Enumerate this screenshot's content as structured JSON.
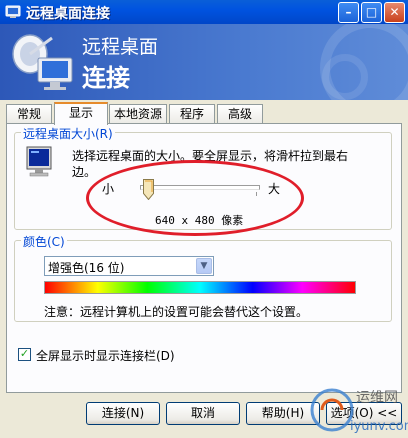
{
  "window": {
    "title": "远程桌面连接",
    "minimize": "–",
    "maximize": "□",
    "close": "✕"
  },
  "banner": {
    "line1": "远程桌面",
    "line2": "连接"
  },
  "tabs": [
    {
      "label": "常规"
    },
    {
      "label": "显示",
      "active": true
    },
    {
      "label": "本地资源"
    },
    {
      "label": "程序"
    },
    {
      "label": "高级"
    }
  ],
  "display_size": {
    "title": "远程桌面大小(R)",
    "description": "选择远程桌面的大小。要全屏显示，将滑杆拉到最右边。",
    "small_label": "小",
    "large_label": "大",
    "resolution": "640 x 480 像素",
    "slider_level": 0
  },
  "colors": {
    "title": "颜色(C)",
    "selected": "增强色(16 位)",
    "note": "注意：远程计算机上的设置可能会替代这个设置。"
  },
  "fullscreen_bar": {
    "label": "全屏显示时显示连接栏(D)",
    "checked": true
  },
  "buttons": {
    "connect": "连接(N)",
    "cancel": "取消",
    "help": "帮助(H)",
    "options": "选项(O) <<"
  },
  "watermark": {
    "text": "运维网",
    "url": "iyunv.com"
  },
  "accent": {
    "title_bar": "#0053e0",
    "group_title": "#0046d5",
    "tab_highlight": "#e68b2c",
    "annotation": "#e01e2a"
  }
}
